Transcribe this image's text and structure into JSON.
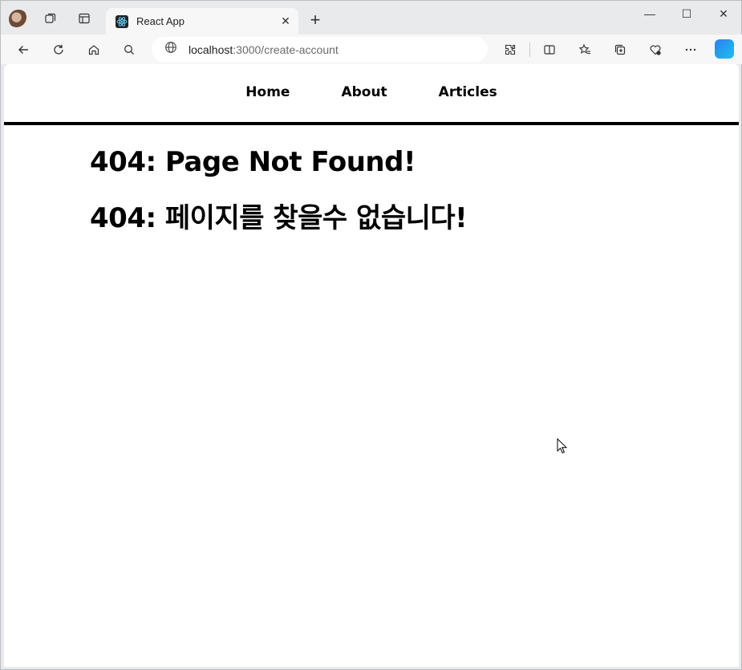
{
  "browser": {
    "tab": {
      "title": "React App"
    },
    "address": {
      "host": "localhost",
      "rest": ":3000/create-account"
    },
    "window_controls": {
      "minimize": "—",
      "maximize": "☐",
      "close": "✕"
    }
  },
  "nav": {
    "items": [
      {
        "label": "Home"
      },
      {
        "label": "About"
      },
      {
        "label": "Articles"
      }
    ]
  },
  "content": {
    "heading_en": "404: Page Not Found!",
    "heading_ko": "404: 페이지를 찾을수 없습니다!"
  },
  "colors": {
    "nav_rule": "#000000",
    "page_bg": "#ffffff",
    "chrome_bg": "#e9eaec"
  }
}
